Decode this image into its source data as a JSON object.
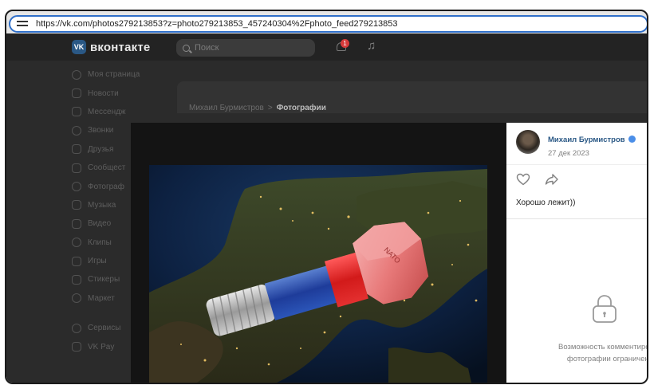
{
  "browser": {
    "url": "https://vk.com/photos279213853?z=photo279213853_457240304%2Fphoto_feed279213853"
  },
  "header": {
    "logo_text": "вконтакте",
    "logo_mark": "VK",
    "search_placeholder": "Поиск",
    "notification_count": "1"
  },
  "sidebar": {
    "items": [
      {
        "label": "Моя страница",
        "icon": "profile-icon"
      },
      {
        "label": "Новости",
        "icon": "news-icon"
      },
      {
        "label": "Мессендж",
        "icon": "messenger-icon"
      },
      {
        "label": "Звонки",
        "icon": "phone-icon"
      },
      {
        "label": "Друзья",
        "icon": "friends-icon"
      },
      {
        "label": "Сообщест",
        "icon": "communities-icon"
      },
      {
        "label": "Фотограф",
        "icon": "photos-icon"
      },
      {
        "label": "Музыка",
        "icon": "music-icon"
      },
      {
        "label": "Видео",
        "icon": "video-icon"
      },
      {
        "label": "Клипы",
        "icon": "clips-icon"
      },
      {
        "label": "Игры",
        "icon": "games-icon"
      },
      {
        "label": "Стикеры",
        "icon": "stickers-icon"
      },
      {
        "label": "Маркет",
        "icon": "market-icon"
      }
    ],
    "extra": [
      {
        "label": "Сервисы",
        "icon": "services-icon"
      },
      {
        "label": "VK Pay",
        "icon": "vkpay-icon"
      }
    ]
  },
  "breadcrumb": {
    "parent": "Михаил Бурмистров",
    "separator": ">",
    "current": "Фотографии"
  },
  "photo_panel": {
    "author": "Михаил Бурмистров",
    "date": "27 дек 2023",
    "caption": "Хорошо лежит))",
    "restricted_line1": "Возможность комментирован",
    "restricted_line2": "фотографии ограничена"
  },
  "colors": {
    "link": "#2a5885",
    "header_bg": "#232323",
    "page_bg": "#2b2b2b",
    "url_border": "#2f6fc9"
  }
}
